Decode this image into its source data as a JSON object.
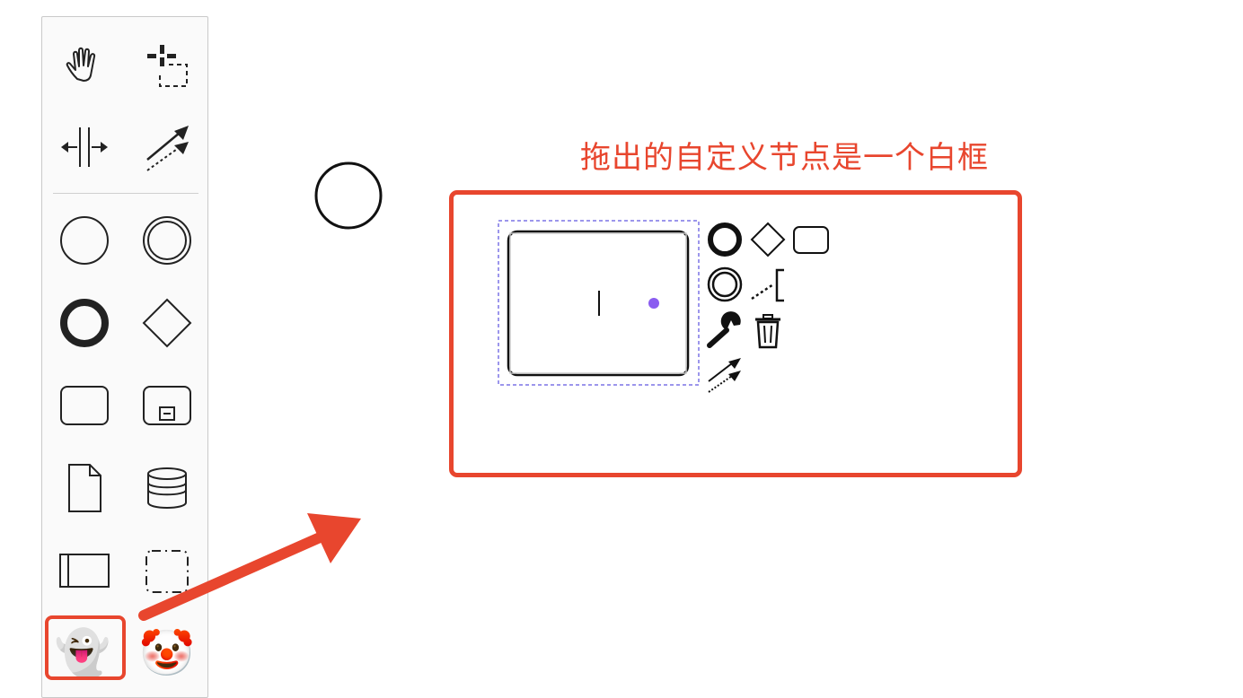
{
  "annotation": {
    "text": "拖出的自定义节点是一个白框"
  },
  "palette": {
    "tools": [
      {
        "name": "hand-tool",
        "icon": "hand-icon"
      },
      {
        "name": "lasso-tool",
        "icon": "lasso-icon"
      },
      {
        "name": "space-tool",
        "icon": "space-icon"
      },
      {
        "name": "global-connect-tool",
        "icon": "connect-icon"
      },
      {
        "name": "start-event",
        "icon": "start-event-icon"
      },
      {
        "name": "intermediate-event",
        "icon": "intermediate-event-icon"
      },
      {
        "name": "end-event",
        "icon": "end-event-icon"
      },
      {
        "name": "gateway",
        "icon": "gateway-icon"
      },
      {
        "name": "task",
        "icon": "task-icon"
      },
      {
        "name": "subprocess",
        "icon": "subprocess-icon"
      },
      {
        "name": "data-object",
        "icon": "data-object-icon"
      },
      {
        "name": "data-store",
        "icon": "data-store-icon"
      },
      {
        "name": "participant",
        "icon": "participant-icon"
      },
      {
        "name": "group",
        "icon": "group-icon"
      }
    ],
    "custom_ghost": "👻",
    "custom_clown": "🤡"
  },
  "colors": {
    "accent": "#e8462e",
    "selection": "#7b73e6",
    "dot": "#8a5cf0"
  }
}
